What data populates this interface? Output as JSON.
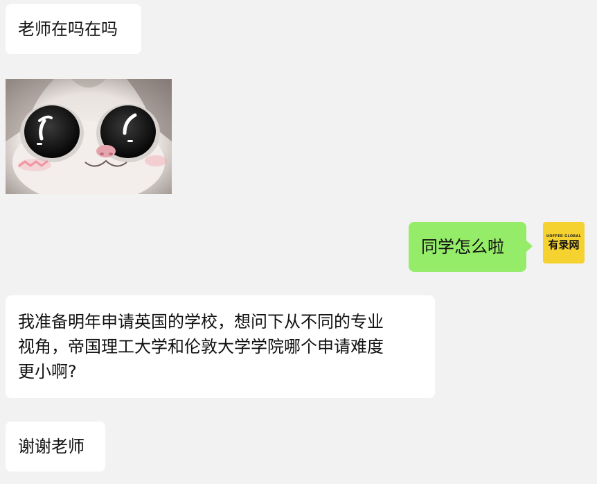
{
  "messages": [
    {
      "side": "left",
      "text": "老师在吗在吗"
    },
    {
      "side": "left",
      "sticker": "cat-big-eyes-sticker"
    },
    {
      "side": "right",
      "text": "同学怎么啦"
    },
    {
      "side": "left",
      "text": "我准备明年申请英国的学校，想问下从不同的专业\n视角，帝国理工大学和伦敦大学学院哪个申请难度\n更小啊?"
    },
    {
      "side": "left",
      "text": "谢谢老师"
    }
  ],
  "avatar": {
    "small_text": "UOFFER GLOBAL",
    "main_text": "有录网"
  },
  "colors": {
    "background": "#f2f2f2",
    "left_bubble": "#ffffff",
    "right_bubble": "#95ec69",
    "avatar_bg": "#f5d230"
  }
}
